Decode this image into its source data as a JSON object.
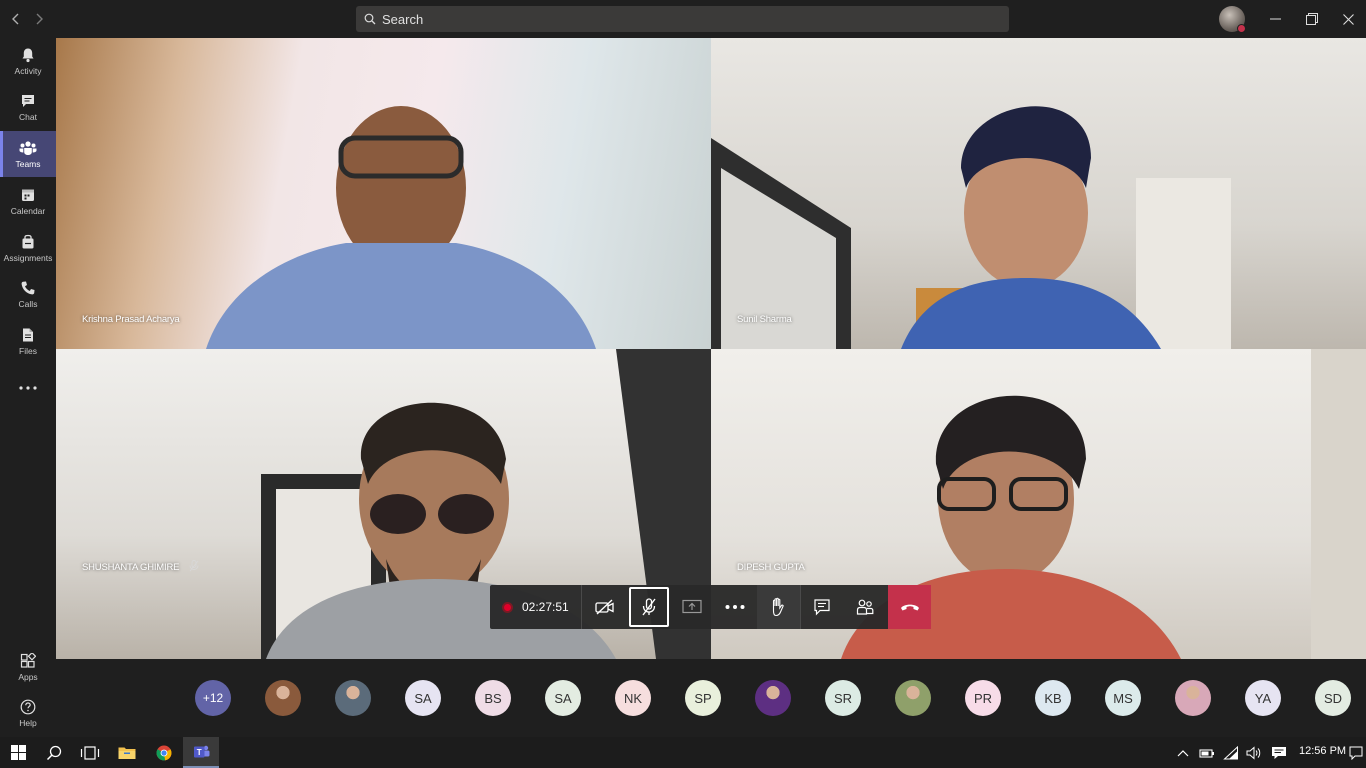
{
  "search": {
    "placeholder": "Search"
  },
  "rail": {
    "items": [
      {
        "label": "Activity",
        "icon": "bell-icon"
      },
      {
        "label": "Chat",
        "icon": "chat-icon"
      },
      {
        "label": "Teams",
        "icon": "teams-icon",
        "active": true
      },
      {
        "label": "Calendar",
        "icon": "calendar-icon"
      },
      {
        "label": "Assignments",
        "icon": "assignments-icon"
      },
      {
        "label": "Calls",
        "icon": "phone-icon"
      },
      {
        "label": "Files",
        "icon": "files-icon"
      }
    ],
    "more": "...",
    "bottom": [
      {
        "label": "Apps",
        "icon": "apps-icon"
      },
      {
        "label": "Help",
        "icon": "help-icon"
      }
    ]
  },
  "participants": [
    {
      "name": "Krishna Prasad Acharya"
    },
    {
      "name": "Sunil Sharma"
    },
    {
      "name": "SHUSHANTA GHIMIRE",
      "muted": true
    },
    {
      "name": "DIPESH GUPTA"
    }
  ],
  "controls": {
    "timer": "02:27:51",
    "recording_color": "#e0002a",
    "hangup_color": "#c4314b"
  },
  "roster": {
    "more": "+12",
    "avatars": [
      {
        "initials": "",
        "type": "photo",
        "color": "#8a5a3c"
      },
      {
        "initials": "",
        "type": "photo",
        "color": "#5b6b7a"
      },
      {
        "initials": "SA",
        "color": "#e6e4f2"
      },
      {
        "initials": "BS",
        "color": "#efdce6"
      },
      {
        "initials": "SA",
        "color": "#e3ece2"
      },
      {
        "initials": "NK",
        "color": "#f6dede"
      },
      {
        "initials": "SP",
        "color": "#e9f0dc"
      },
      {
        "initials": "",
        "type": "photo",
        "color": "#5d2f82"
      },
      {
        "initials": "SR",
        "color": "#dcebe4"
      },
      {
        "initials": "",
        "type": "photo",
        "color": "#8fa06a"
      },
      {
        "initials": "PR",
        "color": "#f7dce8"
      },
      {
        "initials": "KB",
        "color": "#dde8f0"
      },
      {
        "initials": "MS",
        "color": "#dcebeb"
      },
      {
        "initials": "",
        "type": "photo",
        "color": "#d8a8b8"
      },
      {
        "initials": "YA",
        "color": "#e6e4f2"
      },
      {
        "initials": "SD",
        "color": "#e3ece2"
      }
    ]
  },
  "taskbar": {
    "time": "12:56 PM"
  }
}
